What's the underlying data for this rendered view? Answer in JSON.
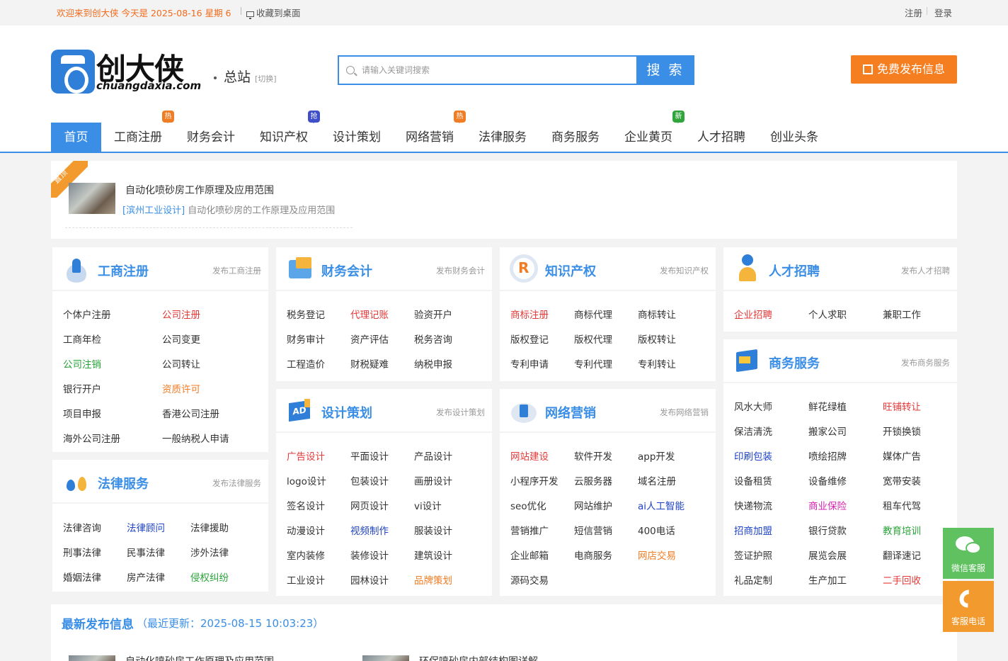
{
  "topbar": {
    "welcome": "欢迎来到创大侠 今天是 2025-08-16 星期 6",
    "bookmark": "收藏到桌面",
    "register": "注册",
    "login": "登录"
  },
  "header": {
    "logo_name": "创大侠",
    "logo_domain": "chuangdaxia.com",
    "city": "总站",
    "city_switch": "[切换]",
    "search_placeholder": "请输入关键词搜索",
    "search_button": "搜 索",
    "post_button": "免费发布信息"
  },
  "nav": {
    "items": [
      {
        "label": "首页"
      },
      {
        "label": "工商注册",
        "badge": "热"
      },
      {
        "label": "财务会计"
      },
      {
        "label": "知识产权",
        "badge": "抢"
      },
      {
        "label": "设计策划"
      },
      {
        "label": "网络营销",
        "badge": "热"
      },
      {
        "label": "法律服务"
      },
      {
        "label": "商务服务"
      },
      {
        "label": "企业黄页",
        "badge": "新"
      },
      {
        "label": "人才招聘"
      },
      {
        "label": "创业头条"
      }
    ]
  },
  "featured": {
    "ribbon": "置顶",
    "title": "自动化喷砂房工作原理及应用范围",
    "tag": "[滨州工业设计]",
    "desc": "自动化喷砂房的工作原理及应用范围"
  },
  "panels": {
    "gongshang": {
      "title": "工商注册",
      "link": "发布工商注册",
      "items": [
        "个体户注册",
        "公司注册",
        "工商年检",
        "公司变更",
        "公司注销",
        "公司转让",
        "银行开户",
        "资质许可",
        "项目申报",
        "香港公司注册",
        "海外公司注册",
        "一般纳税人申请"
      ]
    },
    "falv": {
      "title": "法律服务",
      "link": "发布法律服务",
      "items": [
        "法律咨询",
        "法律顾问",
        "法律援助",
        "刑事法律",
        "民事法律",
        "涉外法律",
        "婚姻法律",
        "房产法律",
        "侵权纠纷"
      ]
    },
    "caiwu": {
      "title": "财务会计",
      "link": "发布财务会计",
      "items": [
        "税务登记",
        "代理记账",
        "验资开户",
        "财务审计",
        "资产评估",
        "税务咨询",
        "工程造价",
        "财税疑难",
        "纳税申报"
      ]
    },
    "sheji": {
      "title": "设计策划",
      "link": "发布设计策划",
      "items": [
        "广告设计",
        "平面设计",
        "产品设计",
        "logo设计",
        "包装设计",
        "画册设计",
        "签名设计",
        "网页设计",
        "vi设计",
        "动漫设计",
        "视频制作",
        "服装设计",
        "室内装修",
        "装修设计",
        "建筑设计",
        "工业设计",
        "园林设计",
        "品牌策划"
      ]
    },
    "zhishi": {
      "title": "知识产权",
      "link": "发布知识产权",
      "items": [
        "商标注册",
        "商标代理",
        "商标转让",
        "版权登记",
        "版权代理",
        "版权转让",
        "专利申请",
        "专利代理",
        "专利转让"
      ]
    },
    "wangluo": {
      "title": "网络营销",
      "link": "发布网络营销",
      "items": [
        "网站建设",
        "软件开发",
        "app开发",
        "小程序开发",
        "云服务器",
        "域名注册",
        "seo优化",
        "网站维护",
        "ai人工智能",
        "营销推广",
        "短信营销",
        "400电话",
        "企业邮箱",
        "电商服务",
        "网店交易",
        "源码交易"
      ]
    },
    "rencai": {
      "title": "人才招聘",
      "link": "发布人才招聘",
      "items": [
        "企业招聘",
        "个人求职",
        "兼职工作"
      ]
    },
    "shangwu": {
      "title": "商务服务",
      "link": "发布商务服务",
      "items": [
        "风水大师",
        "鲜花绿植",
        "旺铺转让",
        "保洁清洗",
        "搬家公司",
        "开锁换锁",
        "印刷包装",
        "喷绘招牌",
        "媒体广告",
        "设备租赁",
        "设备维修",
        "宽带安装",
        "快递物流",
        "商业保险",
        "租车代驾",
        "招商加盟",
        "银行贷款",
        "教育培训",
        "签证护照",
        "展览会展",
        "翻译速记",
        "礼品定制",
        "生产加工",
        "二手回收"
      ]
    }
  },
  "latest": {
    "title": "最新发布信息",
    "updated": "（最近更新：2025-08-15 10:03:23）",
    "item1": "自动化喷砂房工作原理及应用范围",
    "item2": "环保喷砂房内部结构图详解"
  },
  "float": {
    "wechat": "微信客服",
    "phone": "客服电话"
  },
  "colors": {
    "primary": "#3a8ee6",
    "orange": "#f57e21",
    "red": "#e43a3a",
    "green": "#2aa33a",
    "blue": "#1f43c4",
    "pink": "#d625b3"
  }
}
